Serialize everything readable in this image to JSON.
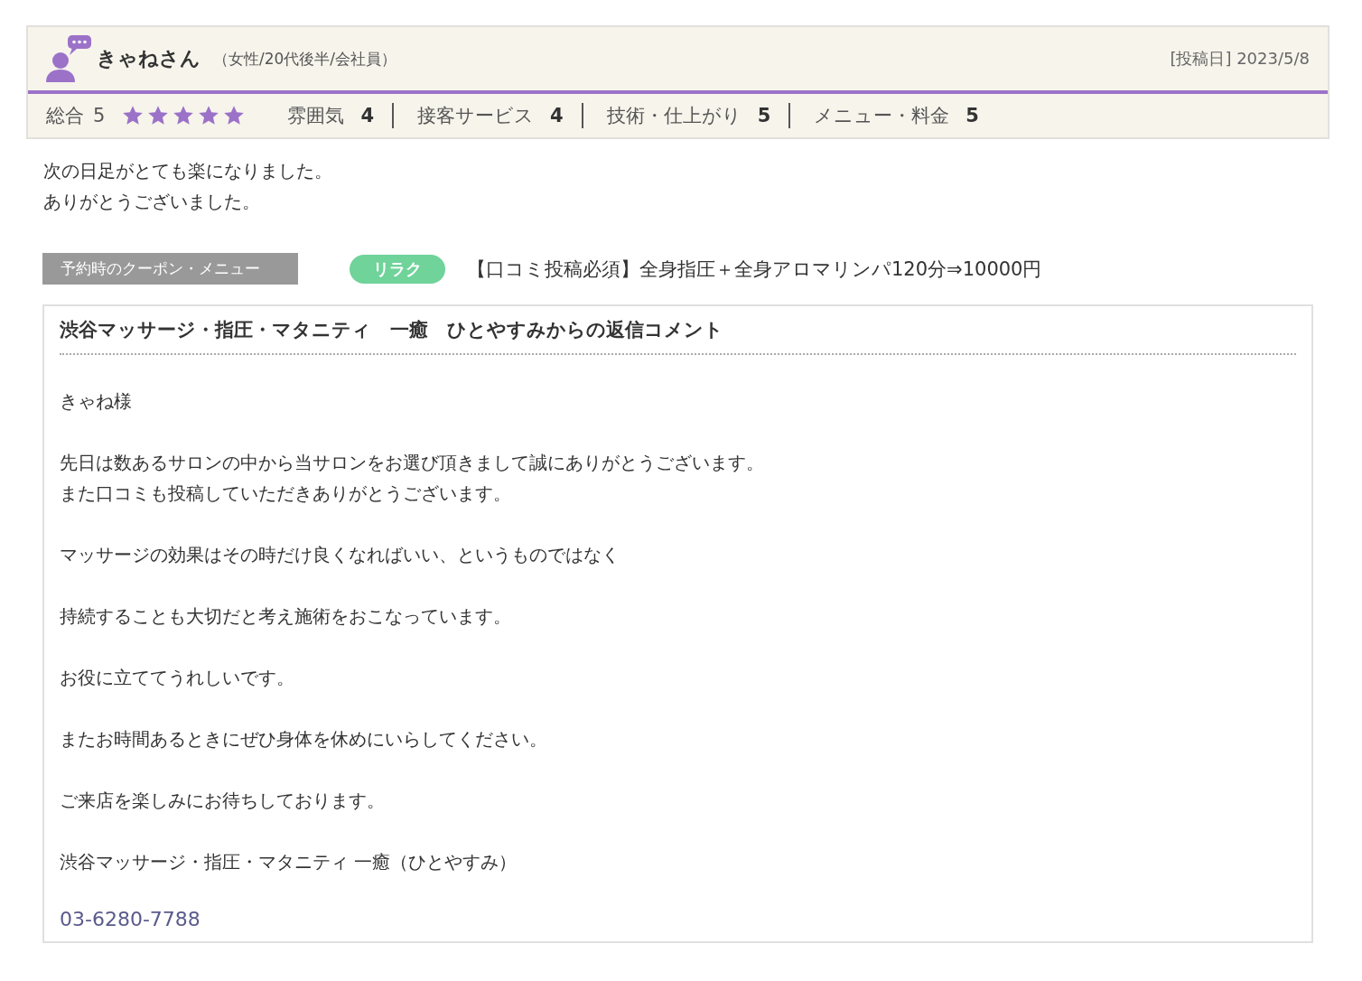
{
  "review": {
    "reviewer": {
      "name": "きゃねさん",
      "profile": "（女性/20代後半/会社員）"
    },
    "post_date": "[投稿日] 2023/5/8",
    "overall": {
      "label": "総合",
      "score": "5",
      "stars": 5
    },
    "ratings": [
      {
        "label": "雰囲気",
        "score": "4"
      },
      {
        "label": "接客サービス",
        "score": "4"
      },
      {
        "label": "技術・仕上がり",
        "score": "5"
      },
      {
        "label": "メニュー・料金",
        "score": "5"
      }
    ],
    "body": [
      "次の日足がとても楽になりました。",
      "ありがとうございました。"
    ],
    "coupon": {
      "label": "予約時のクーポン・メニュー",
      "tag": "リラク",
      "title": "【口コミ投稿必須】全身指圧＋全身アロマリンパ120分⇒10000円"
    }
  },
  "reply": {
    "title": "渋谷マッサージ・指圧・マタニティ　一癒　ひとやすみからの返信コメント",
    "paragraphs": [
      [
        "きゃね様"
      ],
      [
        "先日は数あるサロンの中から当サロンをお選び頂きまして誠にありがとうございます。",
        "また口コミも投稿していただきありがとうございます。"
      ],
      [
        "マッサージの効果はその時だけ良くなればいい、というものではなく"
      ],
      [
        "持続することも大切だと考え施術をおこなっています。"
      ],
      [
        "お役に立ててうれしいです。"
      ],
      [
        "またお時間あるときにぜひ身体を休めにいらしてください。"
      ],
      [
        "ご来店を楽しみにお待ちしております。"
      ],
      [
        "渋谷マッサージ・指圧・マタニティ 一癒（ひとやすみ）"
      ]
    ],
    "phone": "03-6280-7788"
  }
}
